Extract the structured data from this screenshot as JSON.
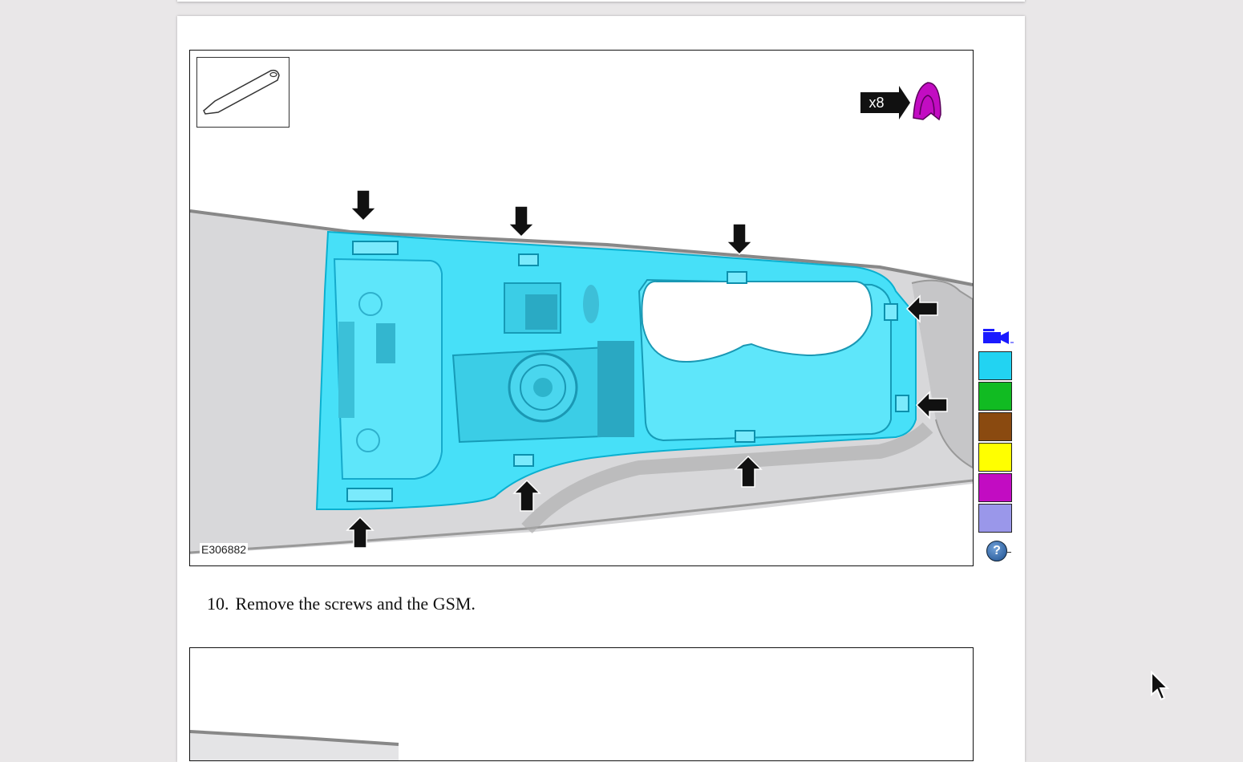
{
  "figure": {
    "id_label": "E306882",
    "quantity_label": "x8"
  },
  "legend": {
    "colors": [
      "#22d3f2",
      "#11bb22",
      "#8a4a10",
      "#ffff00",
      "#c20cc2",
      "#9a97ea"
    ],
    "camera_icon": "video-camera-icon",
    "help_icon": "help-icon",
    "help_glyph": "?"
  },
  "step": {
    "number": "10.",
    "text": "Remove the screws and the GSM."
  },
  "icons": {
    "tool": "trim-tool-icon",
    "clip": "clip-icon",
    "arrows": "arrow-icon"
  }
}
